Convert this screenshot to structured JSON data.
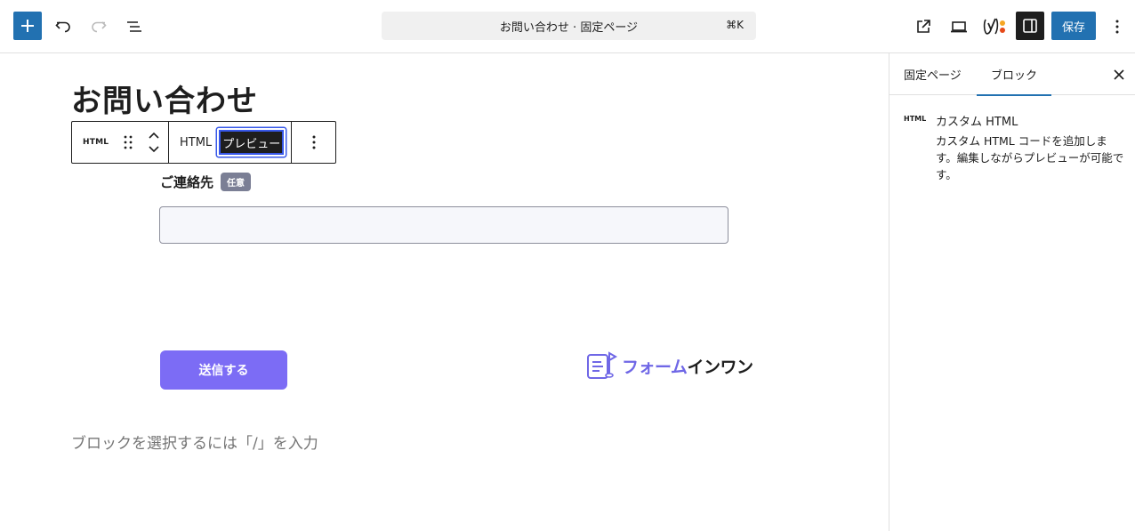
{
  "topbar": {
    "document_title": "お問い合わせ · 固定ページ",
    "shortcut": "⌘K",
    "save_label": "保存",
    "yoast_label": "y"
  },
  "canvas": {
    "page_title": "お問い合わせ",
    "toolbar": {
      "block_icon_label": "HTML",
      "tab_html": "HTML",
      "tab_preview": "プレビュー"
    },
    "field": {
      "label": "ご連絡先",
      "badge": "任意",
      "value": ""
    },
    "submit_label": "送信する",
    "brand": {
      "part_a": "フォーム",
      "part_b": "インワン"
    },
    "placeholder": "ブロックを選択するには「/」を入力"
  },
  "sidebar": {
    "tabs": [
      "固定ページ",
      "ブロック"
    ],
    "active_tab": "ブロック",
    "block": {
      "icon_label": "HTML",
      "title": "カスタム HTML",
      "description": "カスタム HTML コードを追加します。編集しながらプレビューが可能です。"
    }
  },
  "colors": {
    "wp_blue": "#2271b1",
    "submit_purple": "#7c6cf5",
    "badge_gray": "#7b7f95",
    "yoast_red": "#e64a19",
    "yoast_orange": "#f5a623"
  }
}
